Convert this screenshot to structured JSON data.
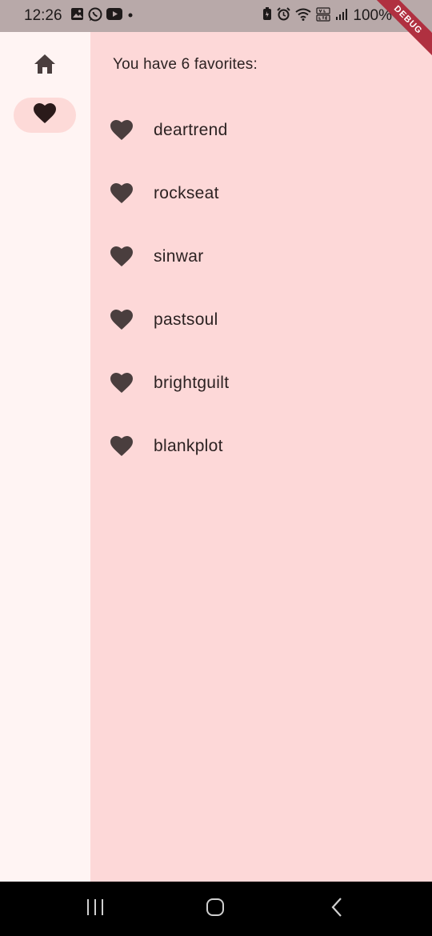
{
  "status_bar": {
    "time": "12:26",
    "battery_text": "100%"
  },
  "debug_banner": "DEBUG",
  "nav_rail": {
    "items": [
      {
        "icon": "home-icon",
        "selected": false
      },
      {
        "icon": "favorite-heart-icon",
        "selected": true
      }
    ]
  },
  "favorites": {
    "header": "You have 6 favorites:",
    "items": [
      {
        "label": "deartrend"
      },
      {
        "label": "rockseat"
      },
      {
        "label": "sinwar"
      },
      {
        "label": "pastsoul"
      },
      {
        "label": "brightguilt"
      },
      {
        "label": "blankplot"
      }
    ]
  },
  "colors": {
    "content_background": "#fdd8d8",
    "rail_background": "#fff4f3",
    "selected_indicator": "#fddad8",
    "icon_color": "#4a3e3e",
    "status_bar": "#b8a9a9"
  }
}
